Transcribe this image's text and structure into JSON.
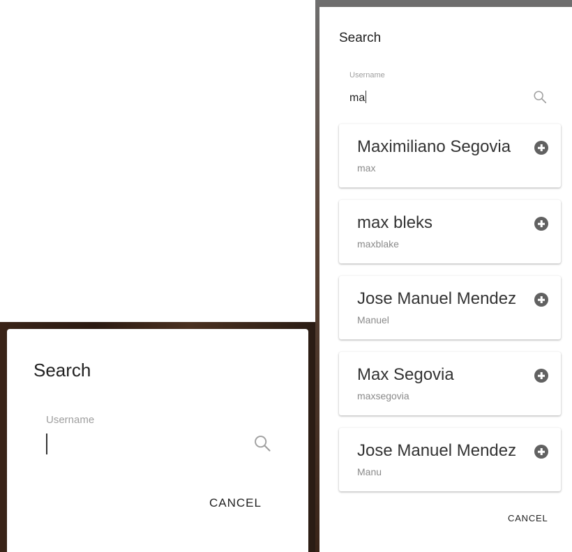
{
  "left_dialog": {
    "title": "Search",
    "field_label": "Username",
    "field_value": "",
    "cancel_label": "CANCEL"
  },
  "right_dialog": {
    "title": "Search",
    "field_label": "Username",
    "field_value": "ma",
    "results": [
      {
        "name": "Maximiliano Segovia",
        "username": "max"
      },
      {
        "name": "max bleks",
        "username": "maxblake"
      },
      {
        "name": "Jose Manuel Mendez",
        "username": "Manuel"
      },
      {
        "name": "Max Segovia",
        "username": "maxsegovia"
      },
      {
        "name": "Jose Manuel Mendez",
        "username": "Manu"
      }
    ],
    "cancel_label": "CANCEL"
  },
  "icons": {
    "search": "search-icon",
    "add": "add-circle-icon"
  },
  "colors": {
    "icon_gray": "#9e9e9e",
    "add_button": "#616161",
    "secondary_text": "#8a8a8a"
  }
}
